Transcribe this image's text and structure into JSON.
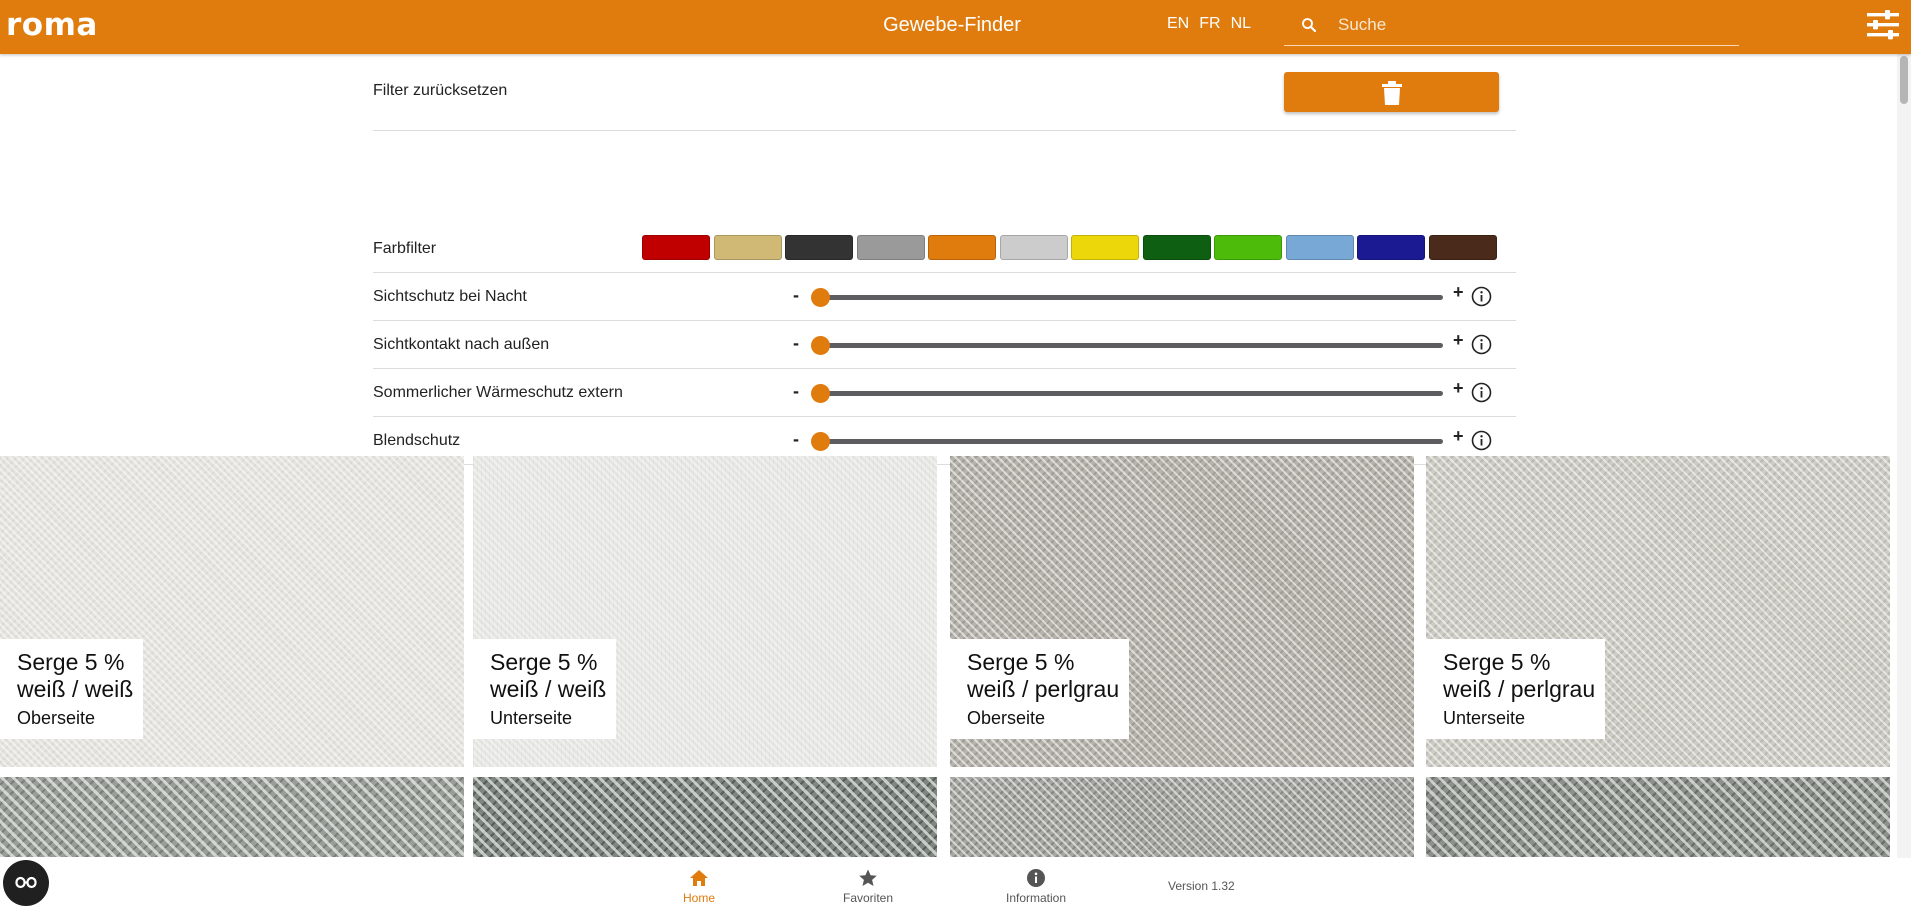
{
  "header": {
    "logo": "roma",
    "title": "Gewebe-Finder",
    "languages": [
      "EN",
      "FR",
      "NL"
    ],
    "search_placeholder": "Suche"
  },
  "filters": {
    "reset_label": "Filter zurücksetzen",
    "color_filter_label": "Farbfilter",
    "colors": [
      "#c00000",
      "#cfb975",
      "#333333",
      "#9a9a9a",
      "#e07b0e",
      "#cccccc",
      "#ecd80a",
      "#0e5f12",
      "#4cbb0a",
      "#77a8d6",
      "#1b1a92",
      "#4a2a1a"
    ],
    "sliders": [
      {
        "label": "Sichtschutz bei Nacht",
        "minus": "-",
        "plus": "+",
        "value": 0
      },
      {
        "label": "Sichtkontakt nach außen",
        "minus": "-",
        "plus": "+",
        "value": 0
      },
      {
        "label": "Sommerlicher Wärmeschutz extern",
        "minus": "-",
        "plus": "+",
        "value": 0
      },
      {
        "label": "Blendschutz",
        "minus": "-",
        "plus": "+",
        "value": 0
      }
    ]
  },
  "fabrics": [
    {
      "line1": "Serge 5 %",
      "line2": "weiß / weiß",
      "side": "Oberseite"
    },
    {
      "line1": "Serge 5 %",
      "line2": "weiß / weiß",
      "side": "Unterseite"
    },
    {
      "line1": "Serge 5 %",
      "line2": "weiß / perlgrau",
      "side": "Oberseite"
    },
    {
      "line1": "Serge 5 %",
      "line2": "weiß / perlgrau",
      "side": "Unterseite"
    }
  ],
  "bottom_nav": {
    "items": [
      {
        "label": "Home",
        "icon": "home-icon",
        "active": true
      },
      {
        "label": "Favoriten",
        "icon": "star-icon",
        "active": false
      },
      {
        "label": "Information",
        "icon": "info-icon",
        "active": false
      }
    ],
    "version": "Version 1.32"
  },
  "theme": {
    "accent": "#e07b0e"
  }
}
